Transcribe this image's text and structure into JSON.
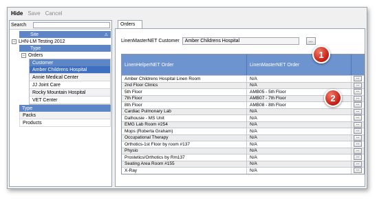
{
  "toolbar": {
    "hide": "Hide",
    "save": "Save",
    "cancel": "Cancel"
  },
  "left": {
    "search_label": "Search",
    "search_value": "",
    "site_header": "Site",
    "sort_indicator": "⚠",
    "site_item": "LHN-LM Testing 2012",
    "type_header": "Type",
    "orders_item": "Orders",
    "customer_header": "Customer",
    "customers": [
      "Amber Childrens Hospital",
      "Annie Medical Center",
      "JJ Joint Care",
      "Rocky Mountain Hospital",
      "VET Center"
    ],
    "type_header2": "Type",
    "types": [
      "Packs",
      "Products"
    ]
  },
  "tab": {
    "label": "Orders"
  },
  "customer_field": {
    "label": "LinenMasterNET Customer",
    "value": "Amber Childrens Hospital",
    "button": "..."
  },
  "grid": {
    "col1": "LinenHelperNET Order",
    "col2": "LinenMasterNET Order",
    "row_button": "...",
    "rows": [
      [
        "Amber Childrens Hospital Linen Room",
        "N/A"
      ],
      [
        "2nd Floor Clinics",
        "N/A"
      ],
      [
        "5th Floor",
        "AMB05 - 5th Floor"
      ],
      [
        "7th Floor",
        "AMB07 - 7th Floor"
      ],
      [
        "8th Floor",
        "AMB08 - 8th Floor"
      ],
      [
        "Cardiac Pulmonary Lab",
        "N/A"
      ],
      [
        "Dalhousie - MS Unit",
        "N/A"
      ],
      [
        "EMG Lab Room #254",
        "N/A"
      ],
      [
        "Mops (Roberta Graham)",
        "N/A"
      ],
      [
        "Occupational Therapy",
        "N/A"
      ],
      [
        "Orthotics-1st Floor by room #137",
        "N/A"
      ],
      [
        "Physio",
        "N/A"
      ],
      [
        "Prostetics/Orthotics by Rm137",
        "N/A"
      ],
      [
        "Seating Area Room #155",
        "N/A"
      ],
      [
        "X-Ray",
        "N/A"
      ]
    ]
  },
  "badges": [
    "1",
    "2"
  ]
}
